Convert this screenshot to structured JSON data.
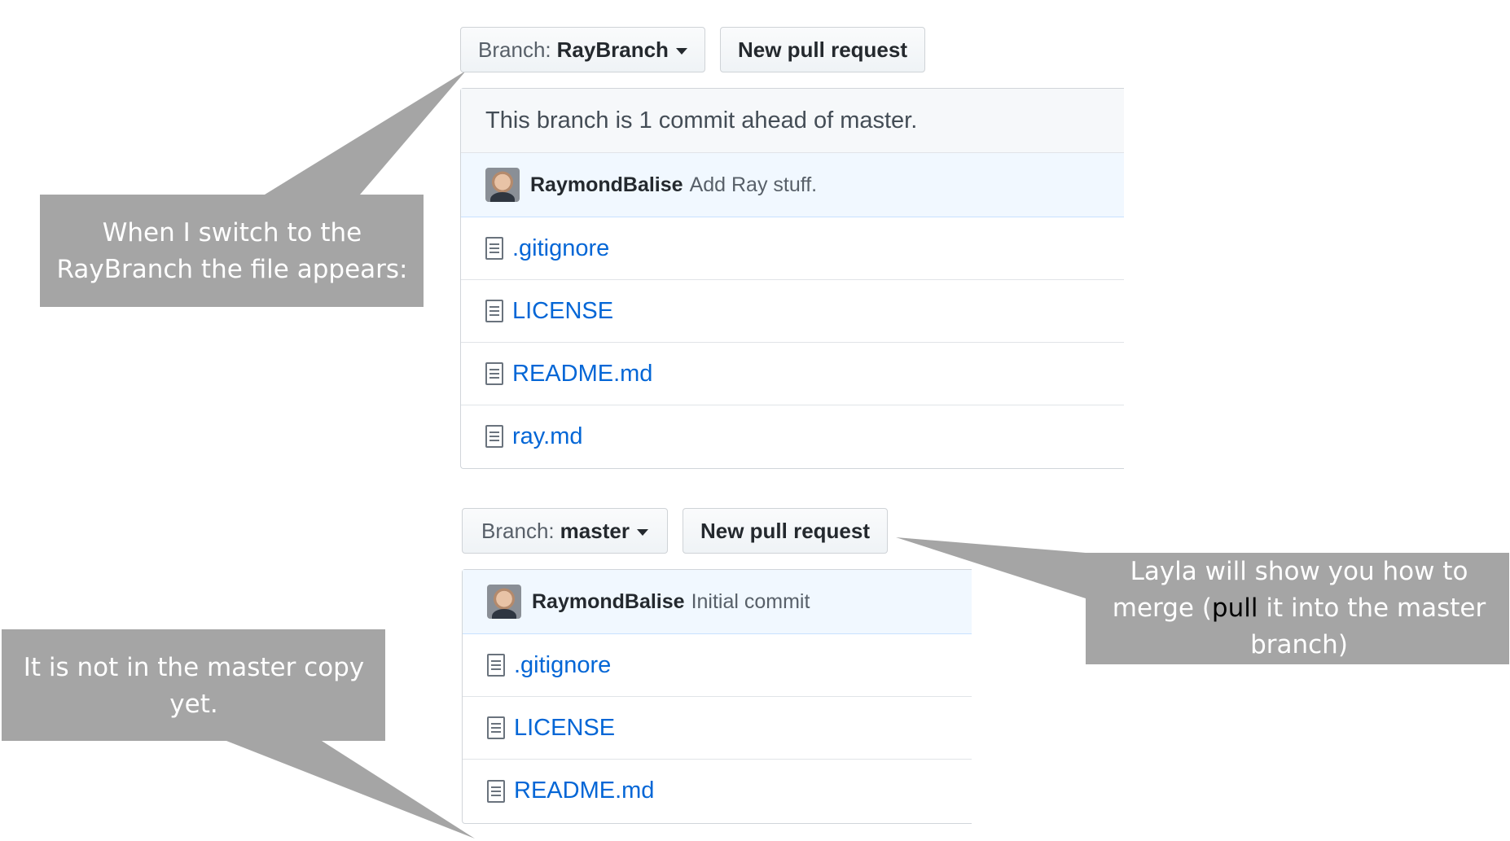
{
  "top": {
    "branch_prefix": "Branch:",
    "branch_name": "RayBranch",
    "new_pr_label": "New pull request",
    "ahead_message": "This branch is 1 commit ahead of master.",
    "commit_author": "RaymondBalise",
    "commit_message": "Add Ray stuff.",
    "files": [
      ".gitignore",
      "LICENSE",
      "README.md",
      "ray.md"
    ]
  },
  "bottom": {
    "branch_prefix": "Branch:",
    "branch_name": "master",
    "new_pr_label": "New pull request",
    "commit_author": "RaymondBalise",
    "commit_message": "Initial commit",
    "files": [
      ".gitignore",
      "LICENSE",
      "README.md"
    ]
  },
  "callouts": {
    "raybranch": "When I switch to the RayBranch the file appears:",
    "master_missing": "It is not in the master copy yet.",
    "merge_before": "Layla will show you how to merge (",
    "merge_highlight": "pull",
    "merge_after": " it into the master branch)"
  },
  "colors": {
    "callout_fill": "#a5a5a5",
    "link_blue": "#0366d6",
    "commit_bg": "#f1f8ff"
  }
}
